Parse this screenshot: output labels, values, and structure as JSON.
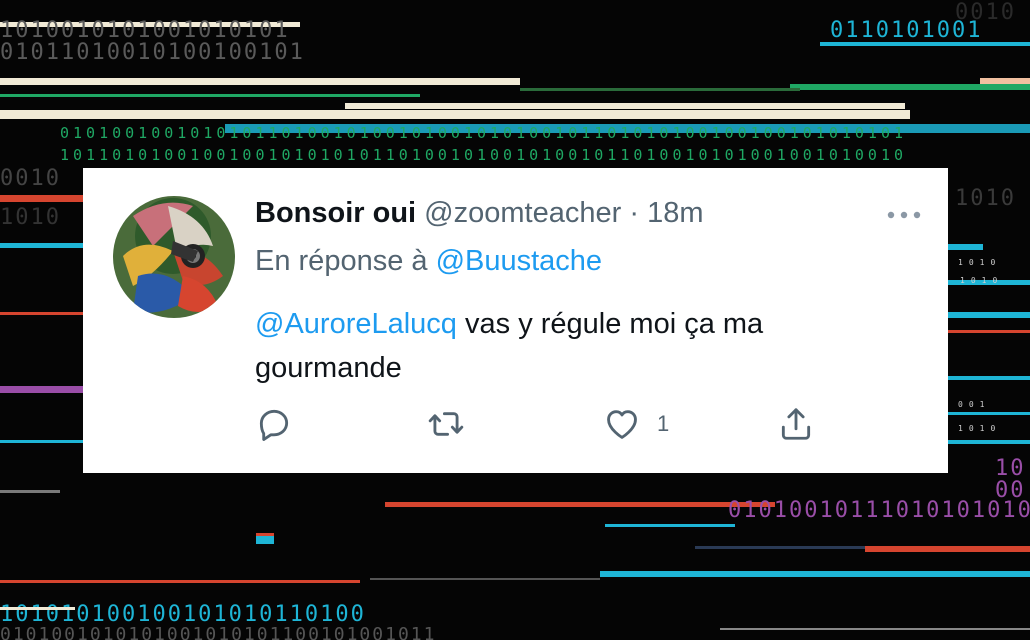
{
  "background": {
    "binary_rows": [
      "1010010101001010101",
      "01011010010100100101",
      "0110101001",
      "01010010010101011010010100101001010100101101010100100100101010101",
      "10110101001001001010101011010010100101001011010010101001001010010",
      "0010",
      "1010",
      "10100",
      "101010100100101010110100",
      "0101001010101001010101100101001011",
      "01010010111010101010",
      "10",
      "00",
      "1010",
      "1010",
      "001"
    ],
    "colors": {
      "cream": "#f1ead6",
      "cyan": "#1eb5d6",
      "green": "#1fa864",
      "red": "#d6452f",
      "purple": "#9a4ea8",
      "gray": "#7a7a7a"
    }
  },
  "tweet": {
    "display_name": "Bonsoir oui",
    "handle": "@zoomteacher",
    "separator": "·",
    "time": "18m",
    "more_icon": "more-horizontal-icon",
    "reply_prefix": "En réponse à",
    "reply_to": "@Buustache",
    "mention": "@AuroreLalucq",
    "body_line1": "vas y régule moi ça ma",
    "body_line2": "gourmande",
    "actions": {
      "reply_icon": "reply-icon",
      "retweet_icon": "retweet-icon",
      "like_icon": "heart-icon",
      "like_count": "1",
      "share_icon": "share-icon"
    },
    "colors": {
      "link": "#1d9bf0",
      "text": "#0f1419",
      "secondary": "#536471"
    }
  }
}
